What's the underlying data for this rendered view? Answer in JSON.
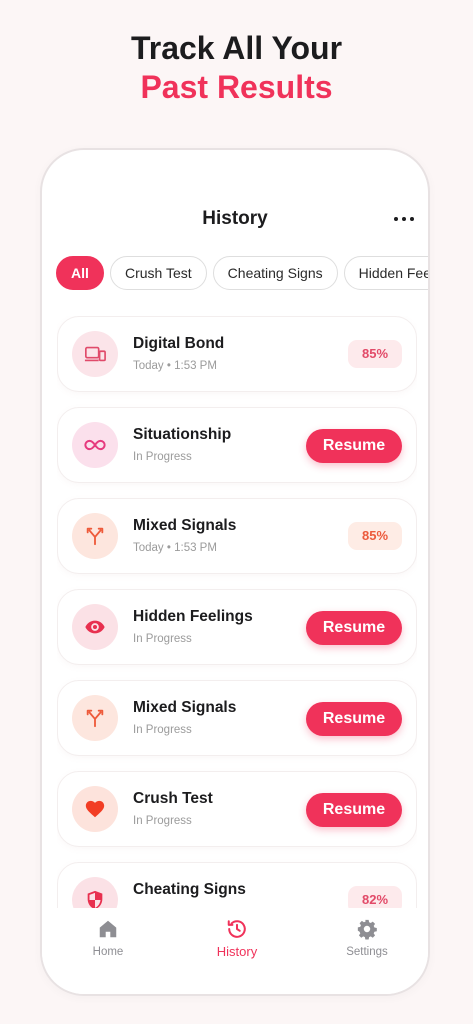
{
  "headline": {
    "line1": "Track All Your",
    "line2": "Past Results"
  },
  "screen": {
    "title": "History",
    "more_icon": "more-horizontal-icon"
  },
  "filters": [
    {
      "label": "All",
      "active": true
    },
    {
      "label": "Crush Test",
      "active": false
    },
    {
      "label": "Cheating Signs",
      "active": false
    },
    {
      "label": "Hidden Feelings",
      "active": false
    }
  ],
  "history": [
    {
      "title": "Digital Bond",
      "subtitle": "Today • 1:53 PM",
      "score": "85%",
      "icon": "devices-icon",
      "icon_color": "#e04a6a",
      "icon_bg": "#fbe4e9",
      "badge_bg": "#fdeaec",
      "badge_color": "#e24a68"
    },
    {
      "title": "Situationship",
      "subtitle": "In Progress",
      "action": "Resume",
      "icon": "infinity-icon",
      "icon_color": "#e6397e",
      "icon_bg": "#fbe0ec"
    },
    {
      "title": "Mixed Signals",
      "subtitle": "Today • 1:53 PM",
      "score": "85%",
      "icon": "split-arrows-icon",
      "icon_color": "#ee5a3a",
      "icon_bg": "#fde6de",
      "badge_bg": "#feece5",
      "badge_color": "#ec5a3c"
    },
    {
      "title": "Hidden Feelings",
      "subtitle": "In Progress",
      "action": "Resume",
      "icon": "eye-icon",
      "icon_color": "#e8304f",
      "icon_bg": "#fbe1e6"
    },
    {
      "title": "Mixed Signals",
      "subtitle": "In Progress",
      "action": "Resume",
      "icon": "split-arrows-icon",
      "icon_color": "#ee5a3a",
      "icon_bg": "#fde6de"
    },
    {
      "title": "Crush Test",
      "subtitle": "In Progress",
      "action": "Resume",
      "icon": "heart-icon",
      "icon_color": "#f23d24",
      "icon_bg": "#fde3dc"
    },
    {
      "title": "Cheating Signs",
      "subtitle": "",
      "score": "82%",
      "icon": "shield-icon",
      "icon_color": "#e8304f",
      "icon_bg": "#fbe1e6",
      "badge_bg": "#fdeaec",
      "badge_color": "#e24a68"
    }
  ],
  "tabbar": [
    {
      "label": "Home",
      "icon": "home-icon",
      "active": false
    },
    {
      "label": "History",
      "icon": "history-icon",
      "active": true
    },
    {
      "label": "Settings",
      "icon": "gear-icon",
      "active": false
    }
  ],
  "colors": {
    "accent": "#f0325a",
    "text": "#1c1c1e",
    "muted": "#9b9b9b",
    "background": "#fcf6f6"
  }
}
